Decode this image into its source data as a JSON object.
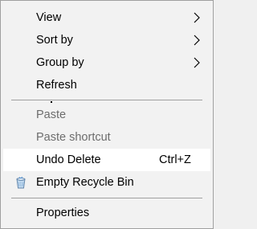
{
  "menu": {
    "view_label": "View",
    "sort_by_label": "Sort by",
    "group_by_label": "Group by",
    "refresh_label": "Refresh",
    "paste_label": "Paste",
    "paste_shortcut_label": "Paste shortcut",
    "undo_delete_label": "Undo Delete",
    "undo_delete_shortcut": "Ctrl+Z",
    "empty_recycle_bin_label": "Empty Recycle Bin",
    "properties_label": "Properties"
  },
  "icons": {
    "submenu": "chevron-right-icon",
    "recycle_bin": "recycle-bin-icon"
  },
  "colors": {
    "menu_background": "#f2f2f2",
    "highlight_background": "#ffffff",
    "disabled_text": "#6d6d6d",
    "separator": "#a0a0a0"
  }
}
